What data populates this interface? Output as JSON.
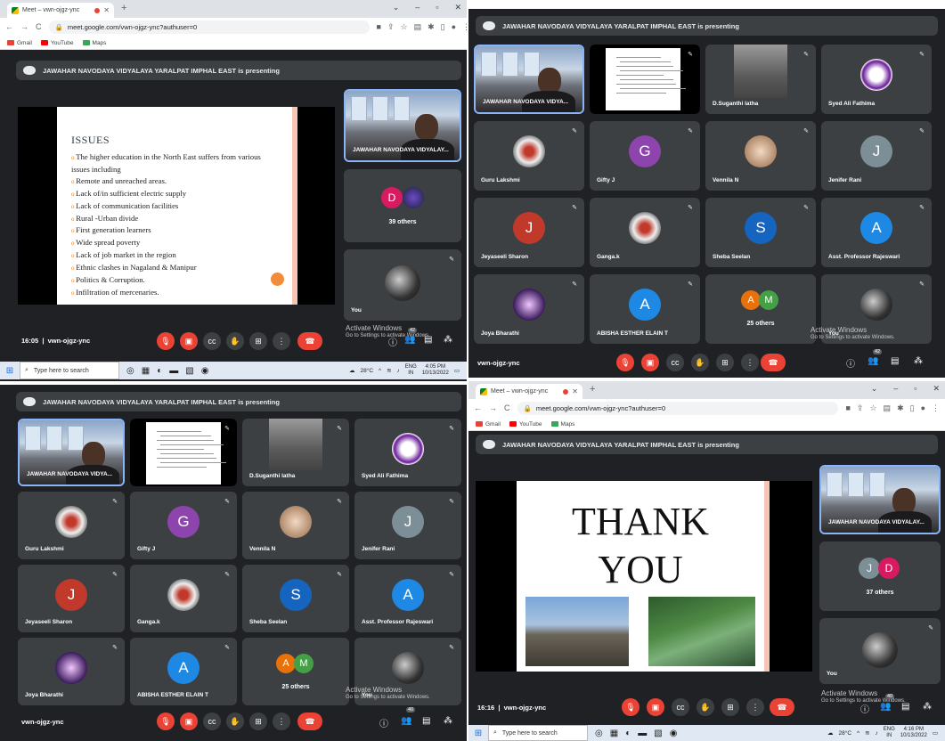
{
  "browser": {
    "tab_title": "Meet – vwn-ojgz-ync",
    "url": "meet.google.com/vwn-ojgz-ync?authuser=0",
    "bookmarks": [
      "Gmail",
      "YouTube",
      "Maps"
    ]
  },
  "meeting": {
    "presenting_banner": "JAWAHAR NAVODAYA VIDYALAYA YARALPAT IMPHAL EAST is presenting",
    "code": "vwn-ojgz-ync",
    "time_q1": "16:05",
    "time_q4": "16:16",
    "separator": "|",
    "people_count": "42",
    "people_count_q4": "40"
  },
  "slide_issues": {
    "heading": "ISSUES",
    "items": [
      "The higher education in the North East suffers from various issues including",
      "Remote and unreached areas.",
      "Lack of/in sufficient electric supply",
      "Lack of communication facilities",
      "Rural -Urban divide",
      "First generation learners",
      "Wide spread poverty",
      "Lack of job market in the region",
      "Ethnic clashes in Nagaland & Manipur",
      "Politics & Corruption.",
      "Infiltration of mercenaries."
    ]
  },
  "slide_thanks": {
    "line1": "THANK",
    "line2": "YOU"
  },
  "presenter_name": "JAWAHAR NAVODAYA VIDYALAY...",
  "presenter_name_grid": "JAWAHAR NAVODAYA VIDYA...",
  "others_q1": {
    "label": "39 others",
    "avatar_letter": "D"
  },
  "others_q4": {
    "label": "37 others",
    "letters": [
      "J",
      "D"
    ]
  },
  "you_label": "You",
  "participants": [
    {
      "name": "D.Suganthi latha",
      "type": "video"
    },
    {
      "name": "Syed Ali Fathima",
      "type": "image"
    },
    {
      "name": "Guru Lakshmi",
      "type": "image"
    },
    {
      "name": "Gifty J",
      "letter": "G",
      "color": "#8e44ad"
    },
    {
      "name": "Vennila N",
      "type": "image"
    },
    {
      "name": "Jenifer Rani",
      "letter": "J",
      "color": "#7d8f96"
    },
    {
      "name": "Jeyaseeli Sharon",
      "letter": "J",
      "color": "#c0392b"
    },
    {
      "name": "Ganga.k",
      "type": "image"
    },
    {
      "name": "Sheba Seelan",
      "letter": "S",
      "color": "#1565c0"
    },
    {
      "name": "Asst. Professor Rajeswari",
      "letter": "A",
      "color": "#1e88e5"
    },
    {
      "name": "Joya Bharathi",
      "type": "image"
    },
    {
      "name": "ABISHA ESTHER ELAIN T",
      "letter": "A",
      "color": "#1e88e5"
    }
  ],
  "others_grid": {
    "label": "25 others",
    "letters": [
      "A",
      "M"
    ],
    "colors": [
      "#e8710a",
      "#43a047"
    ]
  },
  "activate": {
    "title": "Activate Windows",
    "subtitle": "Go to Settings to activate Windows."
  },
  "taskbar": {
    "search_placeholder": "Type here to search",
    "temp": "28°C",
    "lang": "ENG",
    "region": "IN",
    "time_q3": "4:05 PM",
    "time_q4": "4:16 PM",
    "date": "10/13/2022"
  }
}
